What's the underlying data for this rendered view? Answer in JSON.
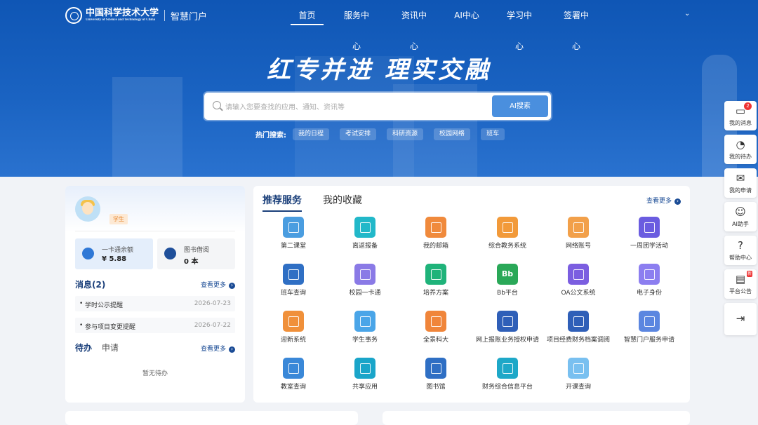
{
  "header": {
    "university": "中国科学技术大学",
    "university_en": "University of Science and Technology of China",
    "portal": "智慧门户",
    "menu": [
      "首页",
      "服务中心",
      "资讯中心",
      "AI中心",
      "学习中心",
      "签署中心"
    ]
  },
  "hero": {
    "slogan": "红专并进  理实交融",
    "search_placeholder": "请输入您要查找的应用、通知、资讯等",
    "search_button": "AI搜索",
    "hot_label": "热门搜索:",
    "hot_tags": [
      "我的日程",
      "考试安排",
      "科研资源",
      "校园网络",
      "班车"
    ]
  },
  "sidebar": [
    {
      "label": "我的消息",
      "icon": "chat-icon",
      "badge": "2"
    },
    {
      "label": "我的待办",
      "icon": "todo-icon"
    },
    {
      "label": "我的申请",
      "icon": "apply-icon"
    },
    {
      "label": "AI助手",
      "icon": "robot-icon"
    },
    {
      "label": "帮助中心",
      "icon": "help-icon"
    },
    {
      "label": "平台公告",
      "icon": "announce-icon",
      "badge": "新"
    },
    {
      "label": "",
      "icon": "collapse-icon"
    }
  ],
  "profile": {
    "role": "学生",
    "card_label": "一卡通余额",
    "card_value": "¥ 5.88",
    "lib_label": "图书借阅",
    "lib_value": "0 本"
  },
  "messages": {
    "title": "消息(2)",
    "more": "查看更多",
    "items": [
      {
        "title": "学时公示提醒",
        "date": "2026-07-23"
      },
      {
        "title": "参与项目变更提醒",
        "date": "2026-07-22"
      }
    ]
  },
  "todo": {
    "tab_todo": "待办",
    "tab_apply": "申请",
    "more": "查看更多",
    "empty": "暂无待办"
  },
  "services": {
    "tab_recommended": "推荐服务",
    "tab_favorites": "我的收藏",
    "more": "查看更多",
    "items": [
      {
        "name": "第二课堂",
        "color": "#4a9de0"
      },
      {
        "name": "离返报备",
        "color": "#22b8c9"
      },
      {
        "name": "我的邮箱",
        "color": "#f08a3c"
      },
      {
        "name": "综合教务系统",
        "color": "#f29a3a"
      },
      {
        "name": "网络账号",
        "color": "#f2a04a"
      },
      {
        "name": "一周团学活动",
        "color": "#6a5ce0"
      },
      {
        "name": "班车查询",
        "color": "#2f6fc4"
      },
      {
        "name": "校园一卡通",
        "color": "#8a7ae6"
      },
      {
        "name": "培养方案",
        "color": "#1fb37a"
      },
      {
        "name": "Bb平台",
        "color": "#2aa858",
        "text": "Bb"
      },
      {
        "name": "OA公文系统",
        "color": "#7b5ee0"
      },
      {
        "name": "电子身份",
        "color": "#8c7ef0"
      },
      {
        "name": "迎新系统",
        "color": "#f0903a"
      },
      {
        "name": "学生事务",
        "color": "#4aa5e8"
      },
      {
        "name": "全景科大",
        "color": "#f0853a"
      },
      {
        "name": "网上报账业务授权申请",
        "color": "#2f5fb8"
      },
      {
        "name": "项目经费财务档案调阅",
        "color": "#2f5fb8"
      },
      {
        "name": "智慧门户服务申请",
        "color": "#5b86e0"
      },
      {
        "name": "教室查询",
        "color": "#3a88d8"
      },
      {
        "name": "共享应用",
        "color": "#1aa5c9"
      },
      {
        "name": "图书馆",
        "color": "#2f6fc4"
      },
      {
        "name": "财务综合信息平台",
        "color": "#1ea8c8"
      },
      {
        "name": "开课查询",
        "color": "#79c0f0"
      }
    ]
  }
}
